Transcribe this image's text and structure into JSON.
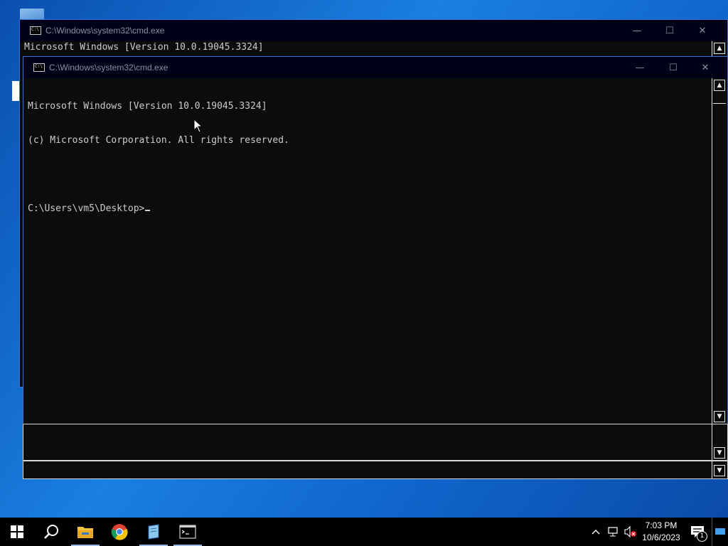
{
  "back_window": {
    "title": "C:\\Windows\\system32\\cmd.exe",
    "line1": "Microsoft Windows [Version 10.0.19045.3324]",
    "line2_partial": "(c) Microsoft Corporation. All rights reserved."
  },
  "front_window": {
    "title": "C:\\Windows\\system32\\cmd.exe",
    "lines": [
      "Microsoft Windows [Version 10.0.19045.3324]",
      "(c) Microsoft Corporation. All rights reserved.",
      "",
      "C:\\Users\\vm5\\Desktop>"
    ]
  },
  "controls": {
    "minimize": "—",
    "maximize": "☐",
    "close": "✕"
  },
  "taskbar": {
    "apps": [
      {
        "name": "start-button",
        "icon": "windows-logo-icon"
      },
      {
        "name": "search-button",
        "icon": "search-icon"
      },
      {
        "name": "file-explorer",
        "icon": "folder-icon"
      },
      {
        "name": "chrome",
        "icon": "chrome-icon"
      },
      {
        "name": "notepad-app",
        "icon": "notepad-icon"
      },
      {
        "name": "cmd-app",
        "icon": "terminal-icon"
      }
    ],
    "time": "7:03 PM",
    "date": "10/6/2023",
    "notification_count": "1"
  },
  "colors": {
    "console_bg": "#0c0c0c",
    "console_text": "#cccccc",
    "titlebar_bg": "#000019",
    "taskbar_bg": "#000000"
  }
}
